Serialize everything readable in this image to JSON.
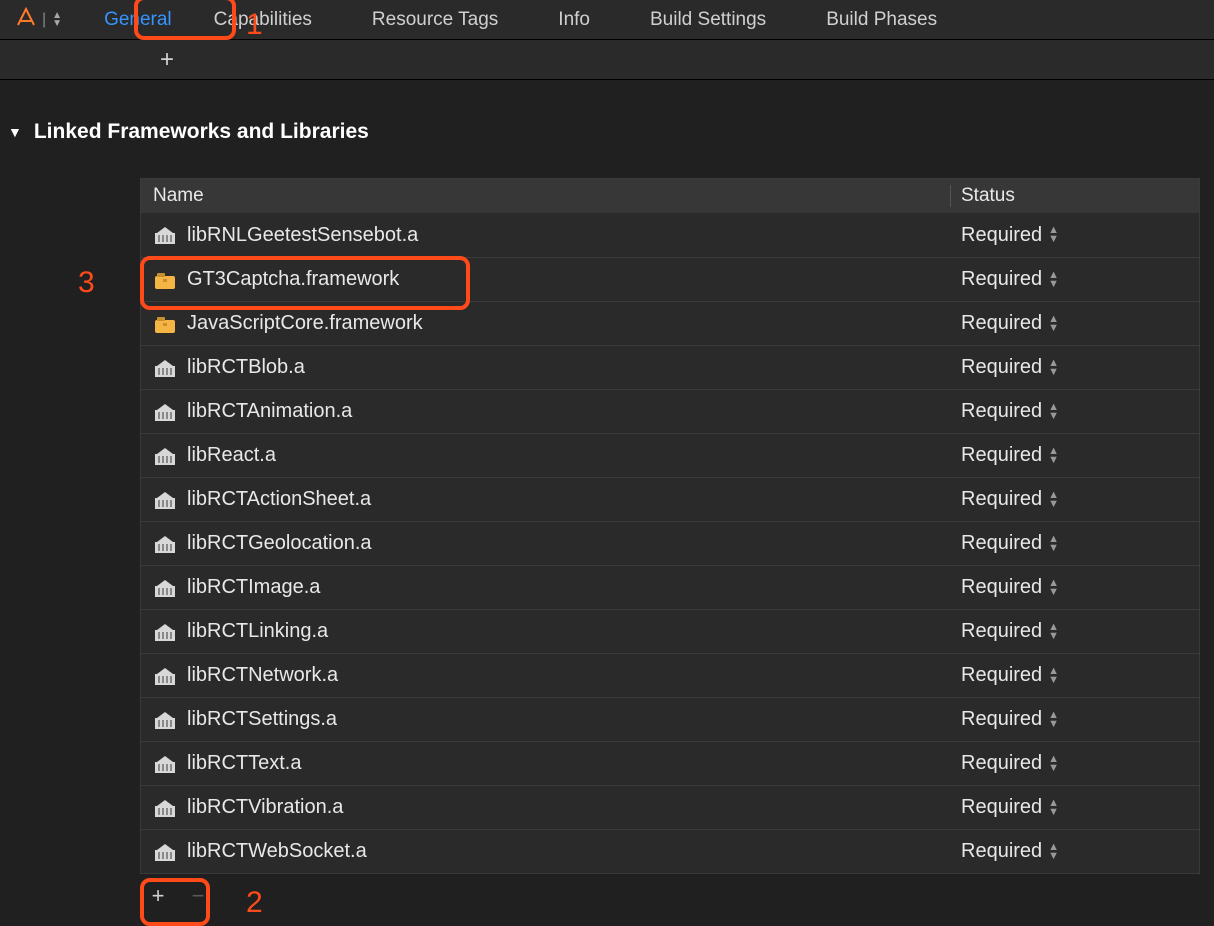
{
  "tabs": [
    {
      "label": "General",
      "active": true
    },
    {
      "label": "Capabilities",
      "active": false
    },
    {
      "label": "Resource Tags",
      "active": false
    },
    {
      "label": "Info",
      "active": false
    },
    {
      "label": "Build Settings",
      "active": false
    },
    {
      "label": "Build Phases",
      "active": false
    }
  ],
  "section": {
    "title": "Linked Frameworks and Libraries"
  },
  "columns": {
    "name": "Name",
    "status": "Status"
  },
  "rows": [
    {
      "name": "libRNLGeetestSensebot.a",
      "icon": "library",
      "status": "Required"
    },
    {
      "name": "GT3Captcha.framework",
      "icon": "framework",
      "status": "Required"
    },
    {
      "name": "JavaScriptCore.framework",
      "icon": "framework",
      "status": "Required"
    },
    {
      "name": "libRCTBlob.a",
      "icon": "library",
      "status": "Required"
    },
    {
      "name": "libRCTAnimation.a",
      "icon": "library",
      "status": "Required"
    },
    {
      "name": "libReact.a",
      "icon": "library",
      "status": "Required"
    },
    {
      "name": "libRCTActionSheet.a",
      "icon": "library",
      "status": "Required"
    },
    {
      "name": "libRCTGeolocation.a",
      "icon": "library",
      "status": "Required"
    },
    {
      "name": "libRCTImage.a",
      "icon": "library",
      "status": "Required"
    },
    {
      "name": "libRCTLinking.a",
      "icon": "library",
      "status": "Required"
    },
    {
      "name": "libRCTNetwork.a",
      "icon": "library",
      "status": "Required"
    },
    {
      "name": "libRCTSettings.a",
      "icon": "library",
      "status": "Required"
    },
    {
      "name": "libRCTText.a",
      "icon": "library",
      "status": "Required"
    },
    {
      "name": "libRCTVibration.a",
      "icon": "library",
      "status": "Required"
    },
    {
      "name": "libRCTWebSocket.a",
      "icon": "library",
      "status": "Required"
    }
  ],
  "annotations": {
    "one": "1",
    "two": "2",
    "three": "3"
  }
}
